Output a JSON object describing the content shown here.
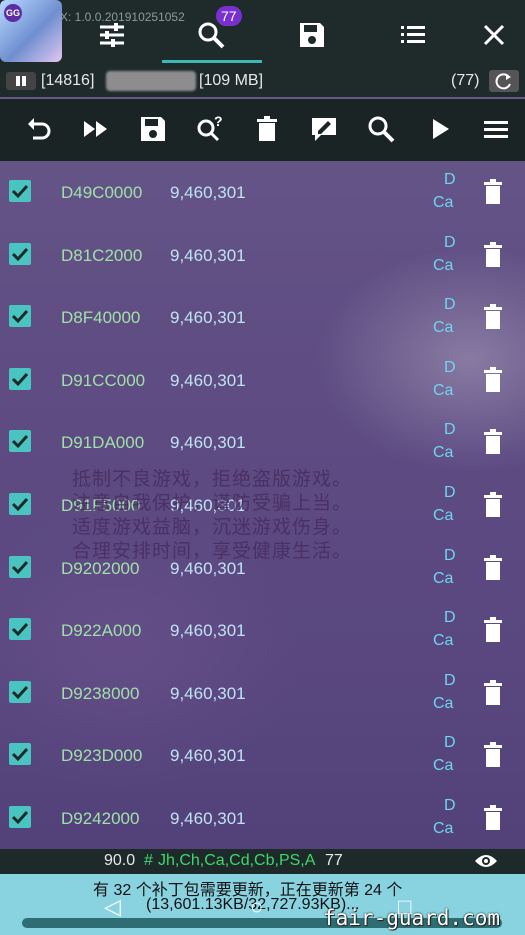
{
  "app": {
    "icon_badge_text": "GG",
    "version_text": "X: 1.0.0.201910251052",
    "notification_count": "77"
  },
  "top_tabs": [
    {
      "name": "settings",
      "icon": "sliders-icon"
    },
    {
      "name": "search",
      "icon": "search-icon",
      "active": true
    },
    {
      "name": "saved",
      "icon": "floppy-icon"
    },
    {
      "name": "list",
      "icon": "list-icon"
    },
    {
      "name": "close",
      "icon": "close-icon"
    }
  ],
  "status": {
    "pid": "[14816]",
    "memory": "[109 MB]",
    "count": "(77)"
  },
  "toolbar": [
    "undo-icon",
    "fast-forward-icon",
    "save-icon",
    "search-help-icon",
    "delete-icon",
    "edit-icon",
    "search-icon",
    "play-icon",
    "menu-icon"
  ],
  "rows": [
    {
      "address": "D49C0000",
      "value": "9,460,301",
      "type_top": "D",
      "type_bottom": "Ca"
    },
    {
      "address": "D81C2000",
      "value": "9,460,301",
      "type_top": "D",
      "type_bottom": "Ca"
    },
    {
      "address": "D8F40000",
      "value": "9,460,301",
      "type_top": "D",
      "type_bottom": "Ca"
    },
    {
      "address": "D91CC000",
      "value": "9,460,301",
      "type_top": "D",
      "type_bottom": "Ca"
    },
    {
      "address": "D91DA000",
      "value": "9,460,301",
      "type_top": "D",
      "type_bottom": "Ca"
    },
    {
      "address": "D91F5000",
      "value": "9,460,301",
      "type_top": "D",
      "type_bottom": "Ca"
    },
    {
      "address": "D9202000",
      "value": "9,460,301",
      "type_top": "D",
      "type_bottom": "Ca"
    },
    {
      "address": "D922A000",
      "value": "9,460,301",
      "type_top": "D",
      "type_bottom": "Ca"
    },
    {
      "address": "D9238000",
      "value": "9,460,301",
      "type_top": "D",
      "type_bottom": "Ca"
    },
    {
      "address": "D923D000",
      "value": "9,460,301",
      "type_top": "D",
      "type_bottom": "Ca"
    },
    {
      "address": "D9242000",
      "value": "9,460,301",
      "type_top": "D",
      "type_bottom": "Ca"
    }
  ],
  "watermark": "抵制不良游戏，拒绝盗版游戏。\n注意自我保护，谨防受骗上当。\n适度游戏益脑，沉迷游戏伤身。\n合理安排时间，享受健康生活。",
  "filter": {
    "number": "90.0",
    "hash": "#",
    "types": "Jh,Ch,Ca,Cd,Cb,PS,A",
    "count": "77"
  },
  "notice": {
    "line1": "有 32 个补丁包需要更新，正在更新第 24 个",
    "line2": "(13,601.13KB/32,727.93KB)..."
  },
  "brand": "fair-guard.com",
  "colors": {
    "accent": "#3bb8b8",
    "checkbox": "#49c4c0",
    "address": "#9fe0a8",
    "type": "#6fd4f0",
    "filter_green": "#3fd76a",
    "notice_bg": "#89d3e1"
  }
}
